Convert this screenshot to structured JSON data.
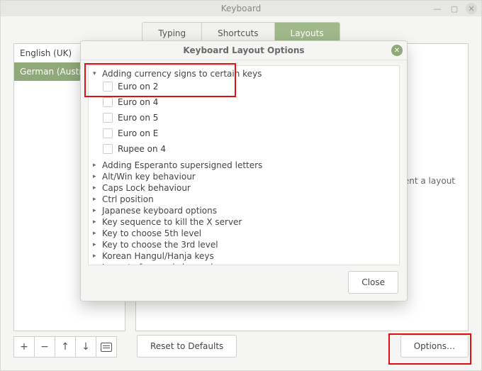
{
  "window": {
    "title": "Keyboard"
  },
  "tabs": {
    "typing": "Typing",
    "shortcuts": "Shortcuts",
    "layouts": "Layouts"
  },
  "sidebar": {
    "items": [
      "English (UK)",
      "German (Austria)"
    ]
  },
  "main": {
    "hint": "epresent a layout"
  },
  "toolbar": {
    "add": "+",
    "remove": "−",
    "up": "↑",
    "down": "↓"
  },
  "buttons": {
    "reset": "Reset to Defaults",
    "options": "Options…",
    "close": "Close"
  },
  "modal": {
    "title": "Keyboard Layout Options",
    "expanded_group": "Adding currency signs to certain keys",
    "options": [
      "Euro on 2",
      "Euro on 4",
      "Euro on 5",
      "Euro on E",
      "Rupee on 4"
    ],
    "collapsed": [
      "Adding Esperanto supersigned letters",
      "Alt/Win key behaviour",
      "Caps Lock behaviour",
      "Ctrl position",
      "Japanese keyboard options",
      "Key sequence to kill the X server",
      "Key to choose 5th level",
      "Key to choose the 3rd level",
      "Korean Hangul/Hanja keys",
      "Layout of numeric keypad"
    ]
  }
}
